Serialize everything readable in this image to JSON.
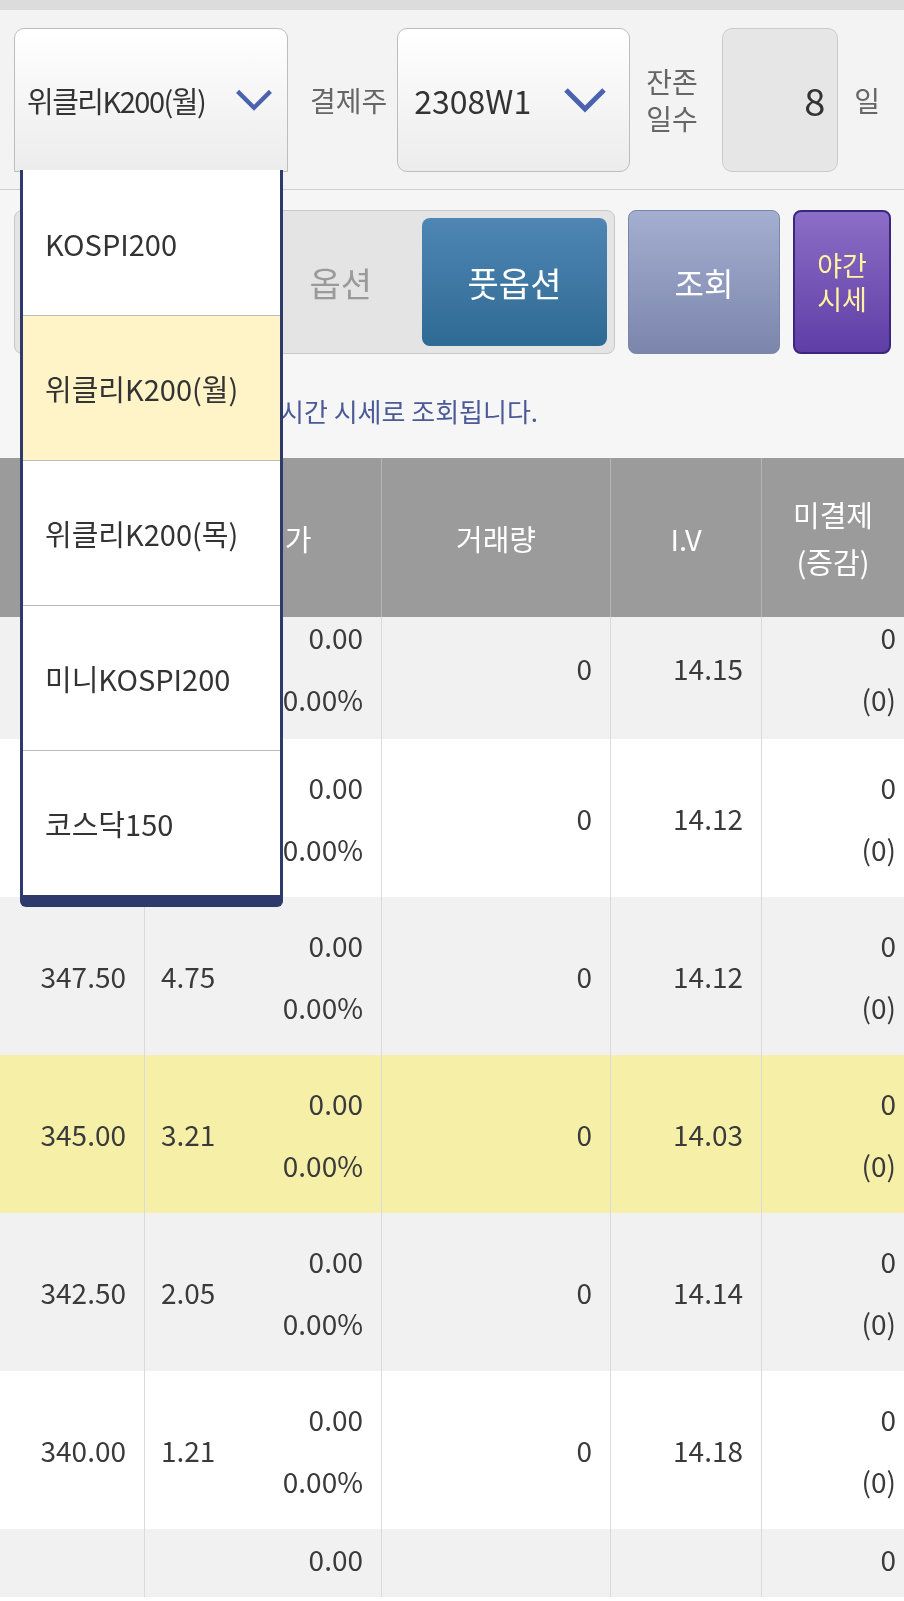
{
  "top": {
    "product_select": {
      "value": "위클리K200(월)",
      "expanded": true
    },
    "settle_label": "결제주",
    "week_select": {
      "value": "2308W1"
    },
    "days_label": "잔존 일수",
    "days_value": "8",
    "days_unit": "일"
  },
  "option_tabs": [
    {
      "label": "옵션",
      "selected": false
    },
    {
      "label": "풋옵션",
      "selected": true
    }
  ],
  "buttons": [
    {
      "label": "조회",
      "kind": "query"
    },
    {
      "label": "야간 시세",
      "kind": "night"
    }
  ],
  "notice": "시간 시세로 조회됩니다.",
  "dropdown": {
    "items": [
      {
        "label": "KOSPI200",
        "selected": false
      },
      {
        "label": "위클리K200(월)",
        "selected": true
      },
      {
        "label": "위클리K200(목)",
        "selected": false
      },
      {
        "label": "미니KOSPI200",
        "selected": false
      },
      {
        "label": "코스닥150",
        "selected": false
      }
    ]
  },
  "table": {
    "headers": {
      "column_2": "가",
      "volume": "거래량",
      "iv": "I.V",
      "open_interest": "미결제\n(증감)"
    },
    "rows": [
      {
        "change": "0.00",
        "change_rate": "0.00%",
        "volume": "0",
        "iv": "14.15",
        "oi": "0",
        "oi_change": "(0)",
        "highlighted": false
      },
      {
        "change": "0.00",
        "change_rate": "0.00%",
        "volume": "0",
        "iv": "14.12",
        "oi": "0",
        "oi_change": "(0)",
        "highlighted": false
      },
      {
        "strike": "347.50",
        "price": "4.75",
        "change": "0.00",
        "change_rate": "0.00%",
        "volume": "0",
        "iv": "14.12",
        "oi": "0",
        "oi_change": "(0)",
        "highlighted": false
      },
      {
        "strike": "345.00",
        "price": "3.21",
        "change": "0.00",
        "change_rate": "0.00%",
        "volume": "0",
        "iv": "14.03",
        "oi": "0",
        "oi_change": "(0)",
        "highlighted": true
      },
      {
        "strike": "342.50",
        "price": "2.05",
        "change": "0.00",
        "change_rate": "0.00%",
        "volume": "0",
        "iv": "14.14",
        "oi": "0",
        "oi_change": "(0)",
        "highlighted": false
      },
      {
        "strike": "340.00",
        "price": "1.21",
        "change": "0.00",
        "change_rate": "0.00%",
        "volume": "0",
        "iv": "14.18",
        "oi": "0",
        "oi_change": "(0)",
        "highlighted": false
      },
      {
        "change": "0.00",
        "oi": "0",
        "highlighted": false
      }
    ]
  }
}
